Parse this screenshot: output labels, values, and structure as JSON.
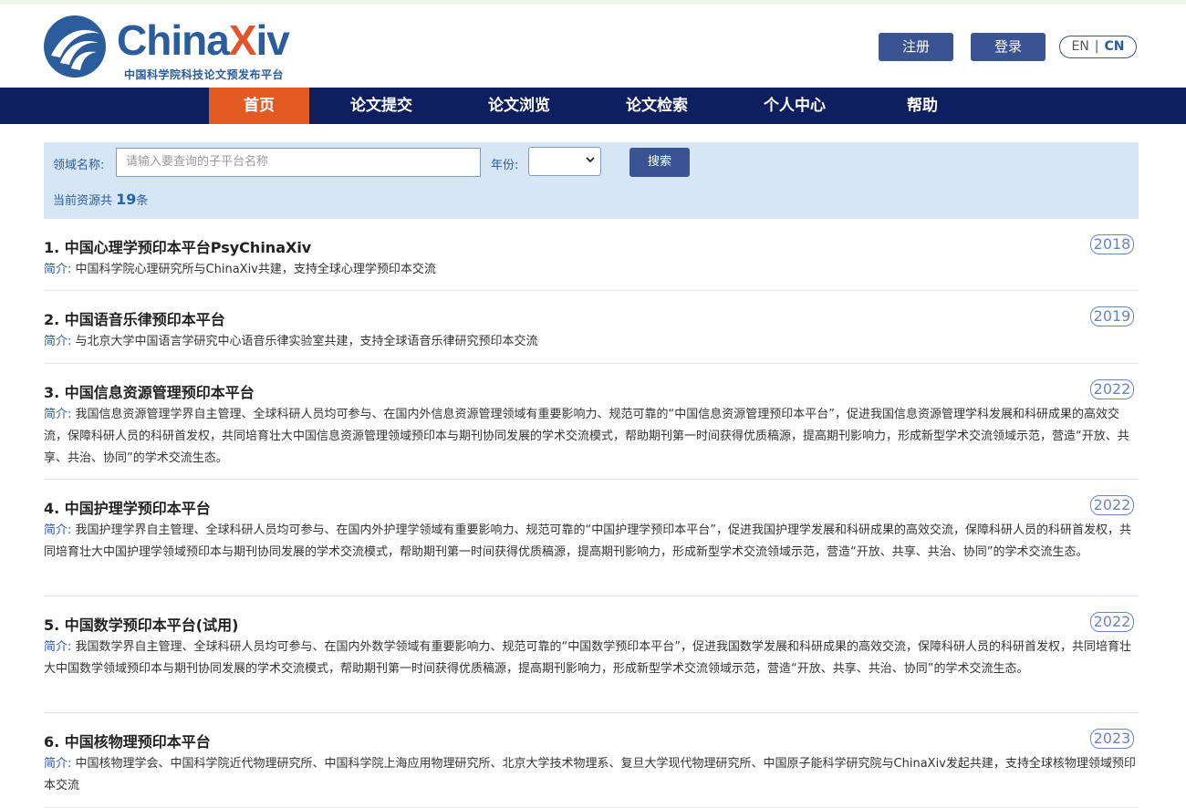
{
  "brand": {
    "name_part1": "China",
    "name_part2": "X",
    "name_part3": "iv",
    "subtitle": "中国科学院科技论文预发布平台"
  },
  "header": {
    "register_label": "注册",
    "login_label": "登录",
    "lang_en": "EN",
    "lang_sep": "|",
    "lang_cn": "CN"
  },
  "nav": {
    "items": [
      {
        "label": "首页",
        "active": true
      },
      {
        "label": "论文提交"
      },
      {
        "label": "论文浏览"
      },
      {
        "label": "论文检索"
      },
      {
        "label": "个人中心"
      },
      {
        "label": "帮助"
      }
    ]
  },
  "search": {
    "field_label": "领域名称:",
    "placeholder": "请输入要查询的子平台名称",
    "year_label": "年份:",
    "year_value": "",
    "button_label": "搜索",
    "count_prefix": "当前资源共",
    "count_value": "19",
    "count_suffix": "条"
  },
  "items": [
    {
      "title": "1. 中国心理学预印本平台PsyChinaXiv",
      "year": "2018",
      "desc_label": "简介:",
      "desc": "中国科学院心理研究所与ChinaXiv共建，支持全球心理学预印本交流"
    },
    {
      "title": "2. 中国语音乐律预印本平台",
      "year": "2019",
      "desc_label": "简介:",
      "desc": "与北京大学中国语言学研究中心语音乐律实验室共建，支持全球语音乐律研究预印本交流"
    },
    {
      "title": "3. 中国信息资源管理预印本平台",
      "year": "2022",
      "desc_label": "简介:",
      "desc": "我国信息资源管理学界自主管理、全球科研人员均可参与、在国内外信息资源管理领域有重要影响力、规范可靠的“中国信息资源管理预印本平台”，促进我国信息资源管理学科发展和科研成果的高效交流，保障科研人员的科研首发权，共同培育壮大中国信息资源管理领域预印本与期刊协同发展的学术交流模式，帮助期刊第一时间获得优质稿源，提高期刊影响力，形成新型学术交流领域示范，营造“开放、共享、共治、协同”的学术交流生态。"
    },
    {
      "title": "4. 中国护理学预印本平台",
      "year": "2022",
      "desc_label": "简介:",
      "desc": "我国护理学界自主管理、全球科研人员均可参与、在国内外护理学领域有重要影响力、规范可靠的“中国护理学预印本平台”，促进我国护理学发展和科研成果的高效交流，保障科研人员的科研首发权，共同培育壮大中国护理学领域预印本与期刊协同发展的学术交流模式，帮助期刊第一时间获得优质稿源，提高期刊影响力，形成新型学术交流领域示范，营造“开放、共享、共治、协同”的学术交流生态。"
    },
    {
      "title": "5. 中国数学预印本平台(试用)",
      "year": "2022",
      "desc_label": "简介:",
      "desc": "我国数学界自主管理、全球科研人员均可参与、在国内外数学领域有重要影响力、规范可靠的“中国数学预印本平台”，促进我国数学发展和科研成果的高效交流，保障科研人员的科研首发权，共同培育壮大中国数学领域预印本与期刊协同发展的学术交流模式，帮助期刊第一时间获得优质稿源，提高期刊影响力，形成新型学术交流领域示范，营造“开放、共享、共治、协同”的学术交流生态。"
    },
    {
      "title": "6. 中国核物理预印本平台",
      "year": "2023",
      "desc_label": "简介:",
      "desc": "中国核物理学会、中国科学院近代物理研究所、中国科学院上海应用物理研究所、北京大学技术物理系、复旦大学现代物理研究所、中国原子能科学研究院与ChinaXiv发起共建，支持全球核物理领域预印本交流"
    }
  ]
}
